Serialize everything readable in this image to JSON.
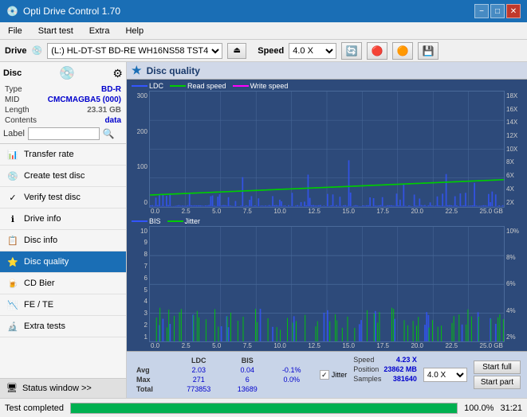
{
  "titleBar": {
    "title": "Opti Drive Control 1.70",
    "minimize": "−",
    "maximize": "□",
    "close": "✕"
  },
  "menuBar": {
    "items": [
      "File",
      "Start test",
      "Extra",
      "Help"
    ]
  },
  "driveBar": {
    "driveLabel": "Drive",
    "driveIconText": "💿",
    "driveValue": "(L:)  HL-DT-ST BD-RE  WH16NS58 TST4",
    "ejectIcon": "⏏",
    "speedLabel": "Speed",
    "speedValue": "4.0 X",
    "icon1": "🔄",
    "icon2": "🔴",
    "icon3": "🟠",
    "icon4": "💾"
  },
  "disc": {
    "title": "Disc",
    "typeLabel": "Type",
    "typeValue": "BD-R",
    "midLabel": "MID",
    "midValue": "CMCMAGBA5 (000)",
    "lengthLabel": "Length",
    "lengthValue": "23.31 GB",
    "contentsLabel": "Contents",
    "contentsValue": "data",
    "labelLabel": "Label",
    "labelValue": ""
  },
  "navItems": [
    {
      "id": "transfer-rate",
      "label": "Transfer rate",
      "icon": "📊"
    },
    {
      "id": "create-test-disc",
      "label": "Create test disc",
      "icon": "💿"
    },
    {
      "id": "verify-test-disc",
      "label": "Verify test disc",
      "icon": "✓"
    },
    {
      "id": "drive-info",
      "label": "Drive info",
      "icon": "ℹ"
    },
    {
      "id": "disc-info",
      "label": "Disc info",
      "icon": "📋"
    },
    {
      "id": "disc-quality",
      "label": "Disc quality",
      "icon": "⭐",
      "active": true
    },
    {
      "id": "cd-bier",
      "label": "CD Bier",
      "icon": "🍺"
    },
    {
      "id": "fe-te",
      "label": "FE / TE",
      "icon": "📉"
    },
    {
      "id": "extra-tests",
      "label": "Extra tests",
      "icon": "🔬"
    }
  ],
  "statusWindow": {
    "label": "Status window >>",
    "icon": "🖥"
  },
  "discQuality": {
    "title": "Disc quality",
    "icon": "⭐"
  },
  "chart1": {
    "legend": [
      {
        "label": "LDC",
        "color": "#3355ff"
      },
      {
        "label": "Read speed",
        "color": "#00cc00"
      },
      {
        "label": "Write speed",
        "color": "#ff00ff"
      }
    ],
    "yLabels": [
      "300",
      "200",
      "100",
      "0"
    ],
    "yLabelsRight": [
      "18X",
      "16X",
      "14X",
      "12X",
      "10X",
      "8X",
      "6X",
      "4X",
      "2X"
    ],
    "xLabels": [
      "0.0",
      "2.5",
      "5.0",
      "7.5",
      "10.0",
      "12.5",
      "15.0",
      "17.5",
      "20.0",
      "22.5",
      "25.0 GB"
    ]
  },
  "chart2": {
    "legend": [
      {
        "label": "BIS",
        "color": "#3355ff"
      },
      {
        "label": "Jitter",
        "color": "#00cc00"
      }
    ],
    "yLabels": [
      "10",
      "9",
      "8",
      "7",
      "6",
      "5",
      "4",
      "3",
      "2",
      "1"
    ],
    "yLabelsRight": [
      "10%",
      "8%",
      "6%",
      "4%",
      "2%"
    ],
    "xLabels": [
      "0.0",
      "2.5",
      "5.0",
      "7.5",
      "10.0",
      "12.5",
      "15.0",
      "17.5",
      "20.0",
      "22.5",
      "25.0 GB"
    ]
  },
  "stats": {
    "columns": [
      "LDC",
      "BIS",
      "",
      "Jitter",
      "Speed"
    ],
    "jitterLabel": "Jitter",
    "jitterChecked": true,
    "jitterCheckmark": "✓",
    "speedValue": "4.23 X",
    "speedSelectValue": "4.0 X",
    "rows": [
      {
        "label": "Avg",
        "ldc": "2.03",
        "bis": "0.04",
        "jitter": "-0.1%"
      },
      {
        "label": "Max",
        "ldc": "271",
        "bis": "6",
        "jitter": "0.0%"
      },
      {
        "label": "Total",
        "ldc": "773853",
        "bis": "13689",
        "jitter": ""
      }
    ],
    "position": {
      "label": "Position",
      "value": "23862 MB",
      "samplesLabel": "Samples",
      "samplesValue": "381640"
    },
    "startFullLabel": "Start full",
    "startPartLabel": "Start part"
  },
  "statusBar": {
    "text": "Test completed",
    "progressPercent": 100,
    "progressText": "100.0%",
    "time": "31:21"
  }
}
